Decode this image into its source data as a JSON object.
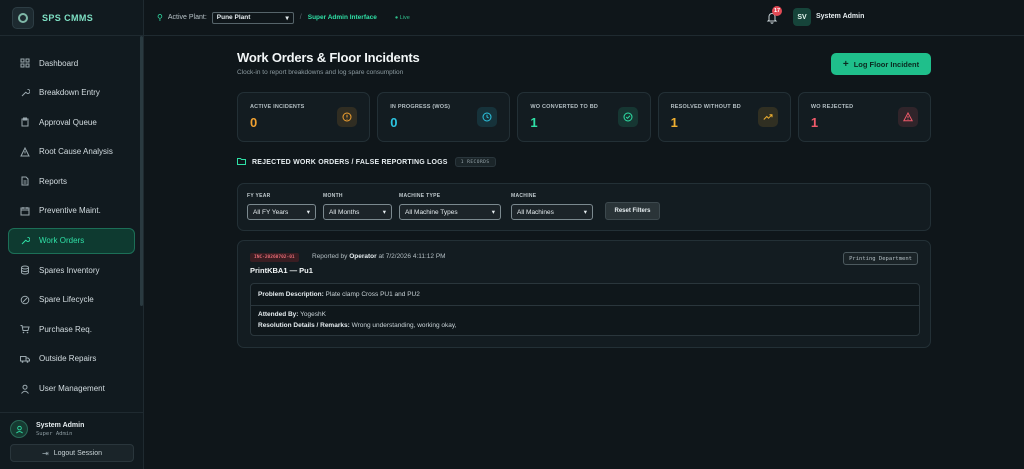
{
  "app": {
    "name": "SPS CMMS"
  },
  "sidebar": {
    "items": [
      {
        "label": "Dashboard",
        "icon": "grid-icon"
      },
      {
        "label": "Breakdown Entry",
        "icon": "wrench-icon"
      },
      {
        "label": "Approval Queue",
        "icon": "clipboard-icon"
      },
      {
        "label": "Root Cause Analysis",
        "icon": "warning-icon"
      },
      {
        "label": "Reports",
        "icon": "file-icon"
      },
      {
        "label": "Preventive Maint.",
        "icon": "calendar-icon"
      },
      {
        "label": "Work Orders",
        "icon": "wrench-icon",
        "active": true
      },
      {
        "label": "Spares Inventory",
        "icon": "database-icon"
      },
      {
        "label": "Spare Lifecycle",
        "icon": "cycle-icon"
      },
      {
        "label": "Purchase Req.",
        "icon": "cart-icon"
      },
      {
        "label": "Outside Repairs",
        "icon": "truck-icon"
      },
      {
        "label": "User Management",
        "icon": "user-icon"
      }
    ],
    "user": {
      "name": "System Admin",
      "role": "Super Admin"
    },
    "logout_label": "Logout Session"
  },
  "topbar": {
    "plant_label": "Active Plant:",
    "plant_value": "Pune Plant",
    "crumb": "Super Admin Interface",
    "live": "● Live",
    "notif_count": "17",
    "avatar": "SV",
    "user_name": "System Admin"
  },
  "page": {
    "title": "Work Orders & Floor Incidents",
    "subtitle": "Clock-in to report breakdowns and log spare consumption",
    "log_button": "Log Floor Incident"
  },
  "stats": [
    {
      "label": "ACTIVE INCIDENTS",
      "value": "0",
      "color": "#f0a030",
      "icon": "alert-circle-icon"
    },
    {
      "label": "IN PROGRESS (WOS)",
      "value": "0",
      "color": "#2cc4e0",
      "icon": "clock-icon"
    },
    {
      "label": "WO CONVERTED TO BD",
      "value": "1",
      "color": "#2fe0a6",
      "icon": "check-circle-icon"
    },
    {
      "label": "RESOLVED WITHOUT BD",
      "value": "1",
      "color": "#f0b030",
      "icon": "trending-up-icon"
    },
    {
      "label": "WO REJECTED",
      "value": "1",
      "color": "#f05a6a",
      "icon": "triangle-alert-icon"
    }
  ],
  "section": {
    "title": "REJECTED WORK ORDERS / FALSE REPORTING LOGS",
    "records": "1 RECORDS"
  },
  "filters": [
    {
      "label": "FY YEAR",
      "value": "All FY Years"
    },
    {
      "label": "MONTH",
      "value": "All Months"
    },
    {
      "label": "MACHINE TYPE",
      "value": "All Machine Types"
    },
    {
      "label": "MACHINE",
      "value": "All Machines"
    }
  ],
  "reset_label": "Reset Filters",
  "incident": {
    "id": "INC-20260702-01",
    "reported_prefix": "Reported by",
    "reported_by": "Operator",
    "reported_at": "at 7/2/2026 4:11:12 PM",
    "machine": "PrintKBA1 — Pu1",
    "department": "Printing Department",
    "problem_label": "Problem Description:",
    "problem": "Plate clamp Cross PU1 and PU2",
    "attended_label": "Attended By:",
    "attended": "YogeshK",
    "remarks_label": "Resolution Details / Remarks:",
    "remarks": "Wrong understanding, working okay,"
  }
}
